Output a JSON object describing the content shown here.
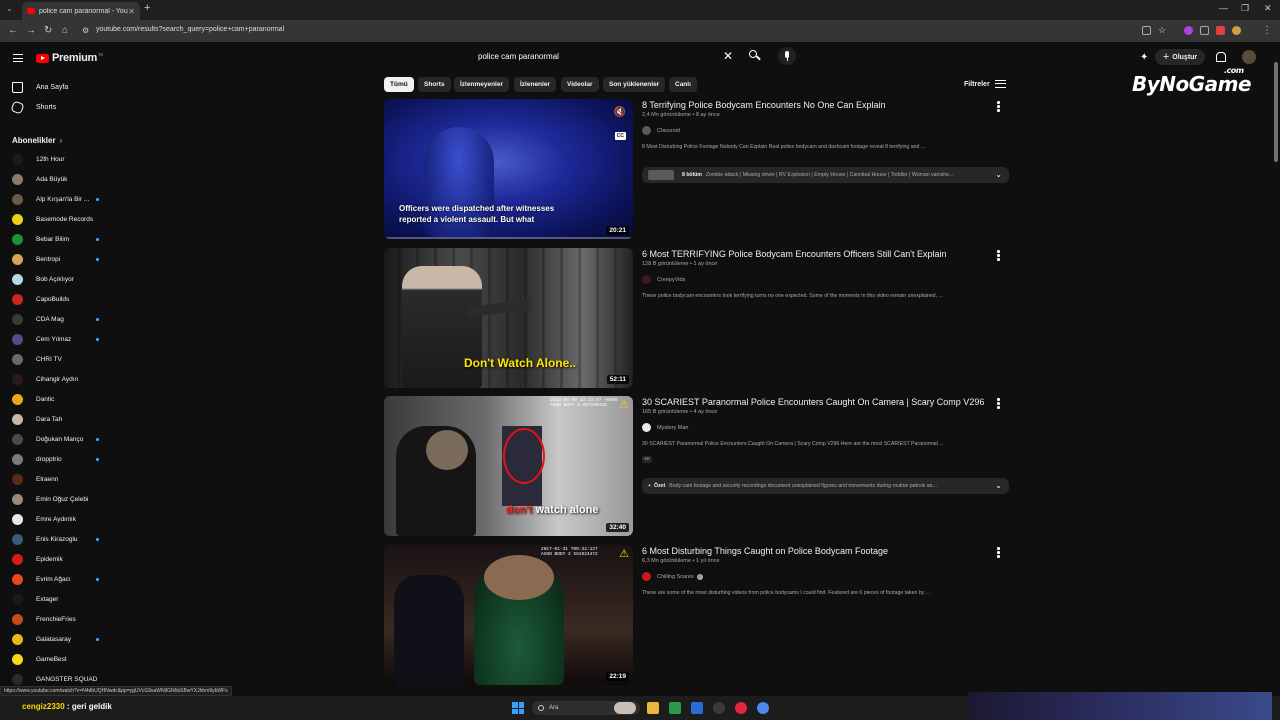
{
  "browser": {
    "tab_title": "police cam paranormal - YouTube",
    "url": "youtube.com/results?search_query=police+cam+paranormal"
  },
  "header": {
    "logo_text": "Premium",
    "logo_tr": "TR",
    "search_value": "police cam paranormal",
    "create_label": "Oluştur"
  },
  "sidebar": {
    "nav": [
      {
        "label": "Ana Sayfa",
        "icon": "home-icon"
      },
      {
        "label": "Shorts",
        "icon": "shorts-icon"
      }
    ],
    "subscriptions_title": "Abonelikler",
    "subscriptions": [
      {
        "name": "12th Hour",
        "color": "#1b1b1b",
        "dot": false
      },
      {
        "name": "Ada Büyük",
        "color": "#8a7a6a",
        "dot": false
      },
      {
        "name": "Alp Kırşan'la Bir ...",
        "color": "#6a5a4a",
        "dot": true
      },
      {
        "name": "Basemode Records",
        "color": "#e8d31a",
        "dot": false
      },
      {
        "name": "Bebar Bilim",
        "color": "#1f8f3a",
        "dot": true
      },
      {
        "name": "Bentropi",
        "color": "#d9a45a",
        "dot": true
      },
      {
        "name": "Bob Açıklıyor",
        "color": "#b8d8e8",
        "dot": false
      },
      {
        "name": "CapoBuilds",
        "color": "#c8281e",
        "dot": false
      },
      {
        "name": "CDA Mag",
        "color": "#3a3a3a",
        "dot": true
      },
      {
        "name": "Cem Yılmaz",
        "color": "#5a4a8a",
        "dot": true
      },
      {
        "name": "CHRI TV",
        "color": "#6a6a6a",
        "dot": false
      },
      {
        "name": "Cihangir Aydın",
        "color": "#2a1a1a",
        "dot": false
      },
      {
        "name": "Dantic",
        "color": "#e8a81a",
        "dot": false
      },
      {
        "name": "Dara Tah",
        "color": "#c8b8a8",
        "dot": false
      },
      {
        "name": "Doğukan Manço",
        "color": "#4a4a4a",
        "dot": true
      },
      {
        "name": "dropptrio",
        "color": "#7a7a7a",
        "dot": true
      },
      {
        "name": "Elraenn",
        "color": "#5a2a1a",
        "dot": false
      },
      {
        "name": "Emin Oğuz Çelebi",
        "color": "#9a8a7a",
        "dot": false
      },
      {
        "name": "Emre Aydınlık",
        "color": "#e8e8e8",
        "dot": false
      },
      {
        "name": "Enis Kirazoglu",
        "color": "#3a5a7a",
        "dot": true
      },
      {
        "name": "Epidemik",
        "color": "#d81a1a",
        "dot": false
      },
      {
        "name": "Evrim Ağacı",
        "color": "#e84a1a",
        "dot": true
      },
      {
        "name": "Extager",
        "color": "#1a1a1a",
        "dot": false
      },
      {
        "name": "FrenchieFries",
        "color": "#c84a1a",
        "dot": false
      },
      {
        "name": "Galatasaray",
        "color": "#e8b81a",
        "dot": true
      },
      {
        "name": "GameBest",
        "color": "#f8d81a",
        "dot": false
      },
      {
        "name": "GANGSTER SQUAD",
        "color": "#2a2a2a",
        "dot": false
      }
    ]
  },
  "chips": {
    "items": [
      "Tümü",
      "Shorts",
      "İzlenmeyenler",
      "İzlenenler",
      "Videolar",
      "Son yüklenenler",
      "Canlı"
    ],
    "filters_label": "Filtreler"
  },
  "results": [
    {
      "title": "8 Terrifying Police Bodycam Encounters No One Can Explain",
      "meta": "2,4 Mn görüntüleme • 8 ay önce",
      "channel": "Chezzoid",
      "description": "8 Most Disturbing Police Footage Nobody Can Explain Real police bodycam and dashcam footage reveal 8 terrifying and ...",
      "duration": "20:21",
      "thumb_caption": "Officers were dispatched after witnesses reported a violent assault. But what",
      "chapters_count": "8 bölüm",
      "chapters_text": "Zombie attack | Missing driver | RV Explosion | Empty House | Cannibal House | Toddler | Woman vanishe...",
      "channel_color": "#5a5a5a"
    },
    {
      "title": "6 Most TERRIFYING Police Bodycam Encounters Officers Still Can't Explain",
      "meta": "128 B görüntüleme • 1 ay önce",
      "channel": "CreepyVids",
      "description": "These police bodycam encounters took terrifying turns no one expected. Some of the moments in this video remain unexplained, ...",
      "duration": "52:11",
      "thumb_caption": "Don't Watch Alone..",
      "channel_color": "#3a1a1a"
    },
    {
      "title": "30 SCARIEST Paranormal Police Encounters Caught On Camera | Scary Comp V296",
      "meta": "165 B görüntüleme • 4 ay önce",
      "channel": "Mystery Man",
      "description": "30 SCARIEST Paranormal Police Encounters Caught On Camera | Scary Comp V296 Here are the most SCARIEST Paranormal ...",
      "badge": "4K",
      "duration": "32:40",
      "thumb_caption_red": "don't",
      "thumb_caption_white": "watch alone",
      "thumb_stamp": "2023-08-09 23:13:47 +0000 AXON BODY 3 X87100133",
      "summary_label": "Özet",
      "summary_text": "Body cam footage and security recordings document unexplained figures and movements during routine patrols an...",
      "channel_color": "#e8e8e8"
    },
    {
      "title": "6 Most Disturbing Things Caught on Police Bodycam Footage",
      "meta": "6,3 Mn görüntüleme • 1 yıl önce",
      "channel": "Chilling Scares",
      "description": "These are some of the most disturbing videos from police bodycams I could find. Featured are 6 pieces of footage taken by ...",
      "duration": "22:19",
      "thumb_stamp": "2017-01-31 T00:32:127 AXON BODY 2 X81024472",
      "channel_color": "#c81a1a"
    }
  ],
  "watermark": {
    "main": "ByNoGame",
    "sub": ".com"
  },
  "status_link": "https://www.youtube.com/watch?v=N4dhUQHNwdc&pp=ygUVcG9saWNlIGNhbSBwYXJhbm9ybWFs",
  "taskbar": {
    "chat_user": "cengiz2330",
    "chat_sep": " : ",
    "chat_msg": "geri geldik",
    "search_label": "Ara"
  }
}
